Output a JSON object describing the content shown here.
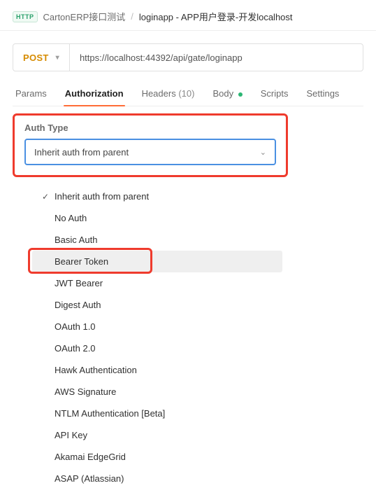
{
  "breadcrumb": {
    "http_badge": "HTTP",
    "collection": "CartonERP接口测试",
    "request": "loginapp - APP用户登录-开发localhost"
  },
  "request": {
    "method": "POST",
    "url": "https://localhost:44392/api/gate/loginapp"
  },
  "tabs": {
    "params": "Params",
    "authorization": "Authorization",
    "headers": "Headers",
    "headers_count": "(10)",
    "body": "Body",
    "scripts": "Scripts",
    "settings": "Settings"
  },
  "auth": {
    "type_label": "Auth Type",
    "selected": "Inherit auth from parent",
    "options": [
      {
        "label": "Inherit auth from parent",
        "checked": true,
        "hover": false
      },
      {
        "label": "No Auth",
        "checked": false,
        "hover": false
      },
      {
        "label": "Basic Auth",
        "checked": false,
        "hover": false
      },
      {
        "label": "Bearer Token",
        "checked": false,
        "hover": true
      },
      {
        "label": "JWT Bearer",
        "checked": false,
        "hover": false
      },
      {
        "label": "Digest Auth",
        "checked": false,
        "hover": false
      },
      {
        "label": "OAuth 1.0",
        "checked": false,
        "hover": false
      },
      {
        "label": "OAuth 2.0",
        "checked": false,
        "hover": false
      },
      {
        "label": "Hawk Authentication",
        "checked": false,
        "hover": false
      },
      {
        "label": "AWS Signature",
        "checked": false,
        "hover": false
      },
      {
        "label": "NTLM Authentication [Beta]",
        "checked": false,
        "hover": false
      },
      {
        "label": "API Key",
        "checked": false,
        "hover": false
      },
      {
        "label": "Akamai EdgeGrid",
        "checked": false,
        "hover": false
      },
      {
        "label": "ASAP (Atlassian)",
        "checked": false,
        "hover": false
      }
    ]
  },
  "colors": {
    "accent": "#ff6c37",
    "highlight_box": "#ef3b2d",
    "select_border": "#4a90e2"
  }
}
